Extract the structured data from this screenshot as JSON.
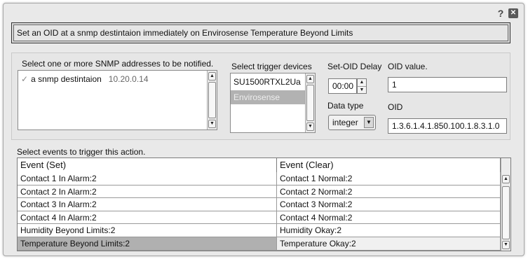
{
  "window": {
    "help_glyph": "?",
    "close_glyph": "✕"
  },
  "description": "Set an OID at a snmp destintaion immediately on Envirosense Temperature Beyond Limits",
  "snmp": {
    "label": "Select one or more SNMP addresses to be notified.",
    "items": [
      {
        "name": "a snmp destintaion",
        "ip": "10.20.0.14"
      }
    ]
  },
  "devices": {
    "label": "Select trigger devices",
    "items": [
      {
        "label": "SU1500RTXL2Ua",
        "selected": false
      },
      {
        "label": "Envirosense",
        "selected": true
      }
    ]
  },
  "delay": {
    "label": "Set-OID Delay",
    "value": "00:00"
  },
  "datatype": {
    "label": "Data type",
    "value": "integer"
  },
  "oid_value": {
    "label": "OID value.",
    "value": "1"
  },
  "oid": {
    "label": "OID",
    "value": "1.3.6.1.4.1.850.100.1.8.3.1.0"
  },
  "events": {
    "label": "Select events to trigger this action.",
    "columns": [
      "Event (Set)",
      "Event (Clear)"
    ],
    "rows": [
      {
        "set": "Contact 1 In Alarm:2",
        "clear": "Contact 1 Normal:2",
        "selected": false
      },
      {
        "set": "Contact 2 In Alarm:2",
        "clear": "Contact 2 Normal:2",
        "selected": false
      },
      {
        "set": "Contact 3 In Alarm:2",
        "clear": "Contact 3 Normal:2",
        "selected": false
      },
      {
        "set": "Contact 4 In Alarm:2",
        "clear": "Contact 4 Normal:2",
        "selected": false
      },
      {
        "set": "Humidity Beyond Limits:2",
        "clear": "Humidity Okay:2",
        "selected": false
      },
      {
        "set": "Temperature Beyond Limits:2",
        "clear": "Temperature Okay:2",
        "selected": true
      }
    ]
  },
  "colors": {
    "selection_gray": "#b0b0b0",
    "dialog_bg": "#e9e9e9"
  }
}
